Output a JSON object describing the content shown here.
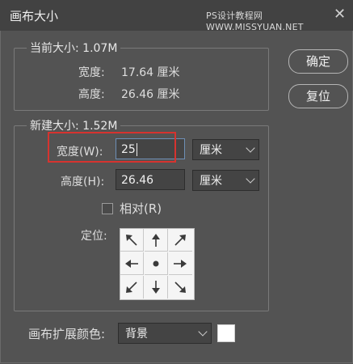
{
  "window": {
    "title": "画布大小",
    "watermark": "PS设计教程网 WWW.MISSYUAN.NET",
    "close_glyph": "✕"
  },
  "current_size": {
    "legend": "当前大小: 1.07M",
    "width_label": "宽度:",
    "width_value": "17.64 厘米",
    "height_label": "高度:",
    "height_value": "26.46 厘米"
  },
  "new_size": {
    "legend": "新建大小: 1.52M",
    "width_label": "宽度(W):",
    "width_value": "25",
    "width_unit": "厘米",
    "height_label": "高度(H):",
    "height_value": "26.46",
    "height_unit": "厘米",
    "relative_label": "相对(R)",
    "relative_checked": false,
    "anchor_label": "定位:",
    "anchor_selected": "center",
    "anchor_icons": [
      "arrow-up-left-icon",
      "arrow-up-icon",
      "arrow-up-right-icon",
      "arrow-left-icon",
      "center-dot-icon",
      "arrow-right-icon",
      "arrow-down-left-icon",
      "arrow-down-icon",
      "arrow-down-right-icon"
    ]
  },
  "buttons": {
    "ok": "确定",
    "reset": "复位"
  },
  "extension_color": {
    "label": "画布扩展颜色:",
    "value": "背景",
    "swatch_color": "#ffffff"
  },
  "colors": {
    "highlight_box": "#d6332f",
    "background": "#535353"
  }
}
